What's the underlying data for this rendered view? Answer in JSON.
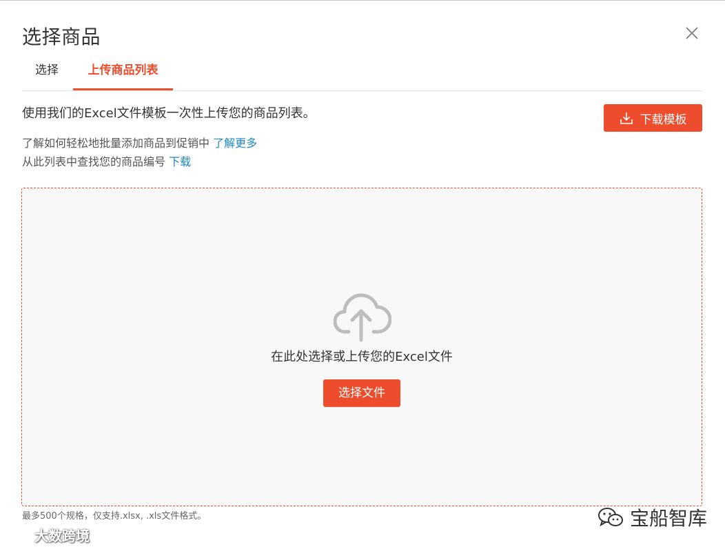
{
  "dialog": {
    "title": "选择商品",
    "close_icon": "close-icon"
  },
  "tabs": [
    {
      "label": "选择",
      "active": false
    },
    {
      "label": "上传商品列表",
      "active": true
    }
  ],
  "intro": {
    "text": "使用我们的Excel文件模板一次性上传您的商品列表。"
  },
  "download_template": {
    "label": "下载模板",
    "icon": "download-icon"
  },
  "info": {
    "line1_text": "了解如何轻松地批量添加商品到促销中 ",
    "line1_link": "了解更多",
    "line2_text": "从此列表中查找您的商品编号 ",
    "line2_link": "下载"
  },
  "dropzone": {
    "icon": "cloud-upload-icon",
    "text": "在此处选择或上传您的Excel文件",
    "button_label": "选择文件"
  },
  "note": "最多500个规格，仅支持.xlsx, .xls文件格式。",
  "watermarks": {
    "left": "大数跨境",
    "right": "宝船智库"
  },
  "colors": {
    "accent": "#ee4d2d",
    "link": "#1e88c7",
    "dropzone_bg": "#f8f8f8"
  }
}
